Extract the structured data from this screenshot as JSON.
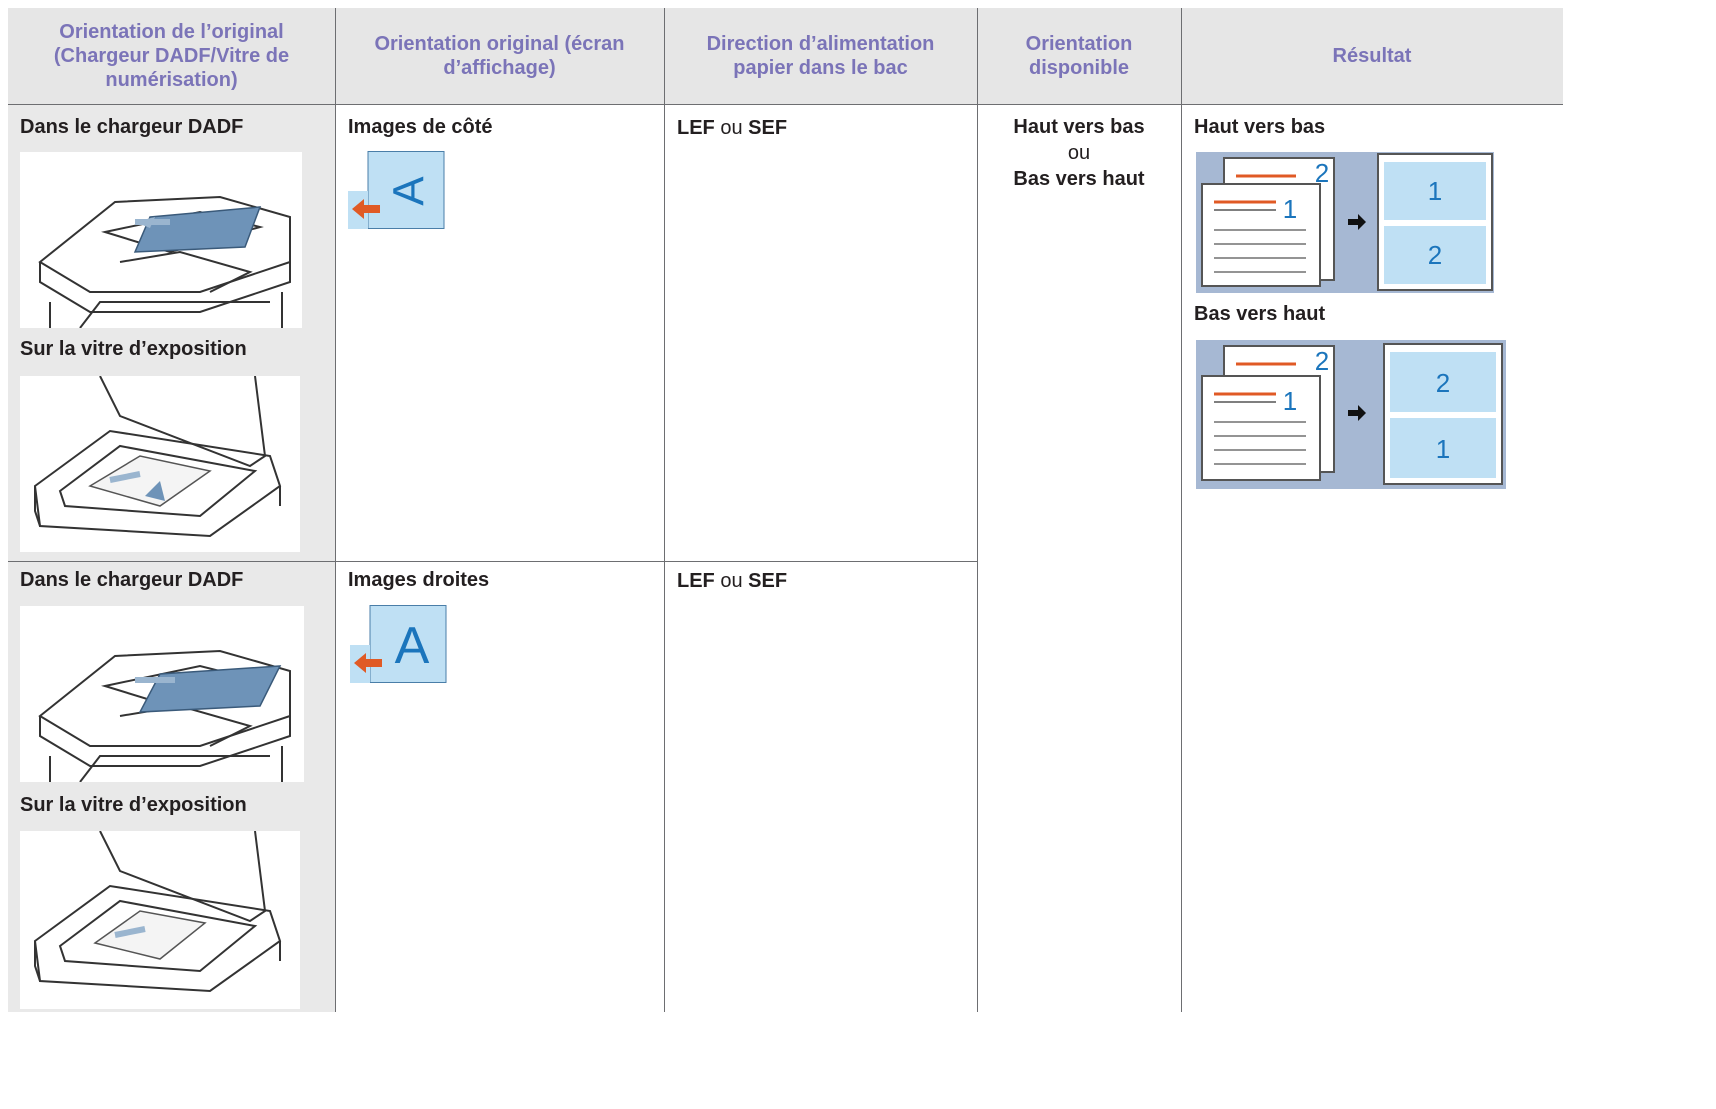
{
  "headers": [
    "Orientation de l’original (Chargeur DADF/Vitre de numérisation)",
    "Orientation original (écran d’affichage)",
    "Direction d’alimentation papier dans le bac",
    "Orientation disponible",
    "Résultat"
  ],
  "colors": {
    "header_text": "#7b74b8",
    "header_bg": "#e6e6e6",
    "col1_bg": "#e9e9e9",
    "accent_blue": "#1b75bc",
    "accent_orange": "#e05a25",
    "panel_blue": "#a6b8d3"
  },
  "rows": [
    {
      "original_dadf": "Dans le chargeur DADF",
      "original_glass": "Sur la vitre d’exposition",
      "display": "Images de côté",
      "display_glyph": "A",
      "feed_lef": "LEF",
      "feed_or": "ou",
      "feed_sef": "SEF"
    },
    {
      "original_dadf": "Dans le chargeur DADF",
      "original_glass": "Sur la vitre d’exposition",
      "display": "Images droites",
      "display_glyph": "A",
      "feed_lef": "LEF",
      "feed_or": "ou",
      "feed_sef": "SEF"
    }
  ],
  "available": {
    "top": "Haut vers bas",
    "or": "ou",
    "bottom": "Bas vers haut"
  },
  "results": [
    {
      "label": "Haut vers bas",
      "back_num": "2",
      "front_num": "1",
      "out_top": "1",
      "out_bottom": "2"
    },
    {
      "label": "Bas vers haut",
      "back_num": "2",
      "front_num": "1",
      "out_top": "2",
      "out_bottom": "1"
    }
  ]
}
